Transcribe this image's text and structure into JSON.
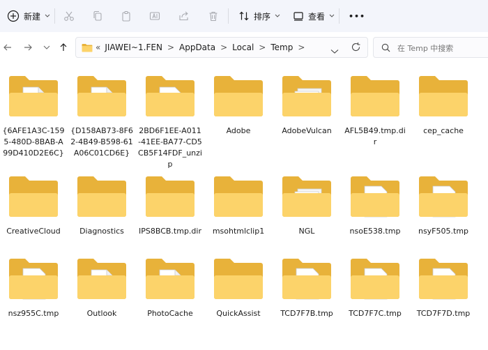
{
  "toolbar": {
    "new_label": "新建",
    "sort_label": "排序",
    "view_label": "查看",
    "more_label": "•••"
  },
  "address": {
    "overflow": "«",
    "segments": [
      "JIAWEI~1.FEN",
      "AppData",
      "Local",
      "Temp"
    ]
  },
  "search": {
    "placeholder": "在 Temp 中搜索"
  },
  "items": [
    {
      "label": "{6AFE1A3C-1595-480D-8BAB-A99D410D2E6C}",
      "overlay": "doc"
    },
    {
      "label": "{D158AB73-8F62-4B49-B598-61A06C01CD6E}",
      "overlay": "doc"
    },
    {
      "label": "2BD6F1EE-A011-41EE-BA77-CD5CB5F14FDF_unzip",
      "overlay": "disc"
    },
    {
      "label": "Adobe",
      "overlay": "none"
    },
    {
      "label": "AdobeVulcan",
      "overlay": "papers"
    },
    {
      "label": "AFL5B49.tmp.dir",
      "overlay": "none"
    },
    {
      "label": "cep_cache",
      "overlay": "none"
    },
    {
      "label": "CreativeCloud",
      "overlay": "none"
    },
    {
      "label": "Diagnostics",
      "overlay": "none"
    },
    {
      "label": "IPS8BCB.tmp.dir",
      "overlay": "none"
    },
    {
      "label": "msohtmlclip1",
      "overlay": "none"
    },
    {
      "label": "NGL",
      "overlay": "papers"
    },
    {
      "label": "nsoE538.tmp",
      "overlay": "gear"
    },
    {
      "label": "nsyF505.tmp",
      "overlay": "gear"
    },
    {
      "label": "nsz955C.tmp",
      "overlay": "gear"
    },
    {
      "label": "Outlook",
      "overlay": "doc"
    },
    {
      "label": "PhotoCache",
      "overlay": "doc"
    },
    {
      "label": "QuickAssist",
      "overlay": "none"
    },
    {
      "label": "TCD7F7B.tmp",
      "overlay": "globe"
    },
    {
      "label": "TCD7F7C.tmp",
      "overlay": "globe"
    },
    {
      "label": "TCD7F7D.tmp",
      "overlay": "globe"
    }
  ],
  "colors": {
    "folder_back": "#e8b23a",
    "folder_front": "#fcd36a",
    "toolbar_bg": "#f3f5fb"
  }
}
